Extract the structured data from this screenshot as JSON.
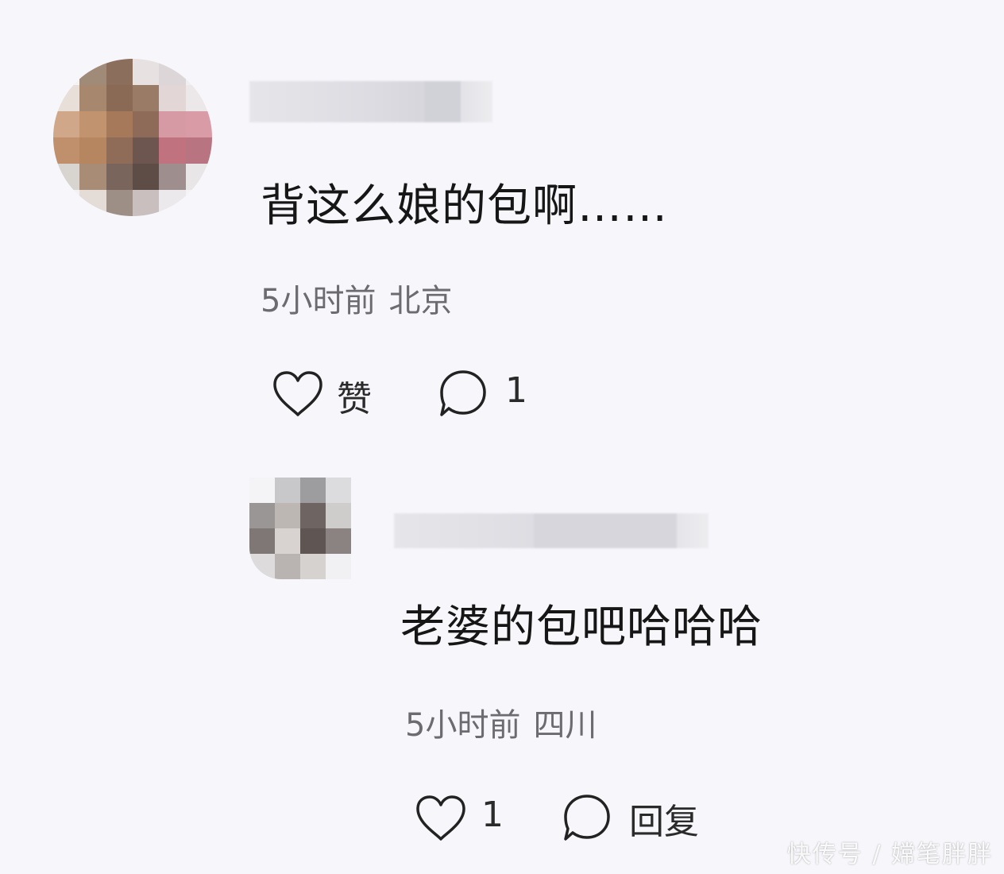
{
  "comments": [
    {
      "text": "背这么娘的包啊……",
      "time": "5小时前",
      "location": "北京",
      "like_label": "赞",
      "reply_count": "1"
    },
    {
      "text": "老婆的包吧哈哈哈",
      "time": "5小时前",
      "location": "四川",
      "like_count": "1",
      "reply_label": "回复"
    }
  ],
  "watermark": "快传号 / 嫦笔胖胖"
}
